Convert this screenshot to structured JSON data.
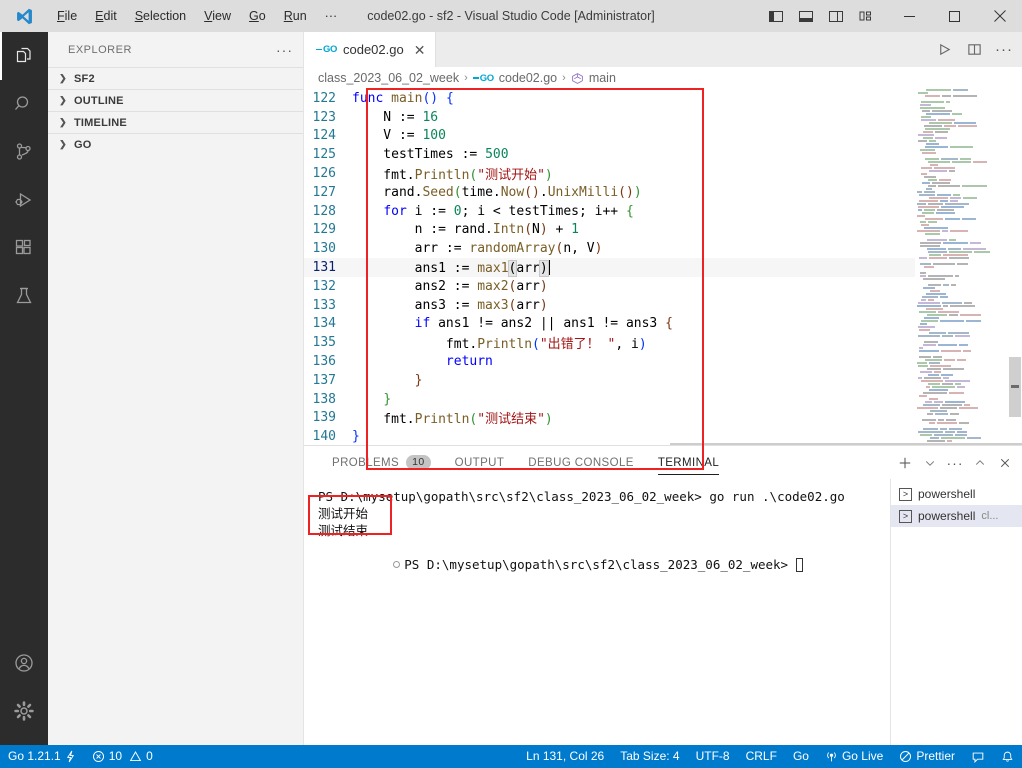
{
  "titlebar": {
    "title": "code02.go - sf2 - Visual Studio Code [Administrator]",
    "menu": [
      "File",
      "Edit",
      "Selection",
      "View",
      "Go",
      "Run",
      "···"
    ],
    "layout_buttons": [
      "toggle-primary-sidebar",
      "toggle-panel",
      "toggle-secondary-sidebar",
      "customize-layout"
    ],
    "window_buttons": {
      "minimize": "—",
      "maximize": "☐",
      "close": "✕"
    }
  },
  "activitybar": {
    "items": [
      {
        "name": "explorer",
        "active": true
      },
      {
        "name": "search",
        "active": false
      },
      {
        "name": "source-control",
        "active": false
      },
      {
        "name": "run-and-debug",
        "active": false
      },
      {
        "name": "extensions",
        "active": false
      },
      {
        "name": "testing",
        "active": false
      }
    ],
    "bottom": [
      {
        "name": "accounts"
      },
      {
        "name": "manage-settings"
      }
    ]
  },
  "sidebar": {
    "header": "EXPLORER",
    "header_more": "···",
    "sections": [
      {
        "label": "SF2",
        "expanded": false
      },
      {
        "label": "OUTLINE",
        "expanded": false
      },
      {
        "label": "TIMELINE",
        "expanded": false
      },
      {
        "label": "GO",
        "expanded": false
      }
    ]
  },
  "editor": {
    "tab": {
      "label": "code02.go",
      "icon": "GO",
      "close": "✕"
    },
    "actions": [
      "run-file",
      "split-editor",
      "more-actions"
    ],
    "breadcrumb": [
      "class_2023_06_02_week",
      "code02.go",
      "main"
    ],
    "breadcrumb_separator": "›",
    "first_line_number": 122,
    "lines": [
      {
        "n": 122,
        "tokens": [
          [
            "kw",
            "func"
          ],
          [
            "plain",
            " "
          ],
          [
            "fn",
            "main"
          ],
          [
            "brkt1",
            "()"
          ],
          [
            "plain",
            " "
          ],
          [
            "brkt1",
            "{"
          ]
        ]
      },
      {
        "n": 123,
        "tokens": [
          [
            "plain",
            "    N := "
          ],
          [
            "num",
            "16"
          ]
        ]
      },
      {
        "n": 124,
        "tokens": [
          [
            "plain",
            "    V := "
          ],
          [
            "num",
            "100"
          ]
        ]
      },
      {
        "n": 125,
        "tokens": [
          [
            "plain",
            "    testTimes := "
          ],
          [
            "num",
            "500"
          ]
        ]
      },
      {
        "n": 126,
        "tokens": [
          [
            "plain",
            "    fmt."
          ],
          [
            "fn",
            "Println"
          ],
          [
            "brkt2",
            "("
          ],
          [
            "str",
            "\"测试开始\""
          ],
          [
            "brkt2",
            ")"
          ]
        ]
      },
      {
        "n": 127,
        "tokens": [
          [
            "plain",
            "    rand."
          ],
          [
            "fn",
            "Seed"
          ],
          [
            "brkt2",
            "("
          ],
          [
            "plain",
            "time."
          ],
          [
            "fn",
            "Now"
          ],
          [
            "brkt3",
            "()"
          ],
          [
            "plain",
            "."
          ],
          [
            "fn",
            "UnixMilli"
          ],
          [
            "brkt3",
            "()"
          ],
          [
            "brkt2",
            ")"
          ]
        ]
      },
      {
        "n": 128,
        "tokens": [
          [
            "plain",
            "    "
          ],
          [
            "kw",
            "for"
          ],
          [
            "plain",
            " i := "
          ],
          [
            "num",
            "0"
          ],
          [
            "plain",
            "; i < testTimes; i++ "
          ],
          [
            "brkt2",
            "{"
          ]
        ]
      },
      {
        "n": 129,
        "tokens": [
          [
            "plain",
            "        n := rand."
          ],
          [
            "fn",
            "Intn"
          ],
          [
            "brkt3",
            "("
          ],
          [
            "plain",
            "N"
          ],
          [
            "brkt3",
            ")"
          ],
          [
            "plain",
            " + "
          ],
          [
            "num",
            "1"
          ]
        ]
      },
      {
        "n": 130,
        "tokens": [
          [
            "plain",
            "        arr := "
          ],
          [
            "fn",
            "randomArray"
          ],
          [
            "brkt3",
            "("
          ],
          [
            "plain",
            "n, V"
          ],
          [
            "brkt3",
            ")"
          ]
        ]
      },
      {
        "n": 131,
        "tokens": [
          [
            "plain",
            "        ans1 := "
          ],
          [
            "fn",
            "max1"
          ],
          [
            "sel",
            "("
          ],
          [
            "plain",
            "arr"
          ],
          [
            "sel",
            ")"
          ]
        ],
        "current": true
      },
      {
        "n": 132,
        "tokens": [
          [
            "plain",
            "        ans2 := "
          ],
          [
            "fn",
            "max2"
          ],
          [
            "brkt3",
            "("
          ],
          [
            "plain",
            "arr"
          ],
          [
            "brkt3",
            ")"
          ]
        ]
      },
      {
        "n": 133,
        "tokens": [
          [
            "plain",
            "        ans3 := "
          ],
          [
            "fn",
            "max3"
          ],
          [
            "brkt3",
            "("
          ],
          [
            "plain",
            "arr"
          ],
          [
            "brkt3",
            ")"
          ]
        ]
      },
      {
        "n": 134,
        "tokens": [
          [
            "plain",
            "        "
          ],
          [
            "kw",
            "if"
          ],
          [
            "plain",
            " ans1 != ans2 || ans1 != ans3 "
          ],
          [
            "brkt3",
            "{"
          ]
        ]
      },
      {
        "n": 135,
        "tokens": [
          [
            "plain",
            "            fmt."
          ],
          [
            "fn",
            "Println"
          ],
          [
            "brkt1",
            "("
          ],
          [
            "str",
            "\"出错了！ \""
          ],
          [
            "plain",
            ", i"
          ],
          [
            "brkt1",
            ")"
          ]
        ]
      },
      {
        "n": 136,
        "tokens": [
          [
            "plain",
            "            "
          ],
          [
            "kw",
            "return"
          ]
        ]
      },
      {
        "n": 137,
        "tokens": [
          [
            "plain",
            "        "
          ],
          [
            "brkt3",
            "}"
          ]
        ]
      },
      {
        "n": 138,
        "tokens": [
          [
            "plain",
            "    "
          ],
          [
            "brkt2",
            "}"
          ]
        ]
      },
      {
        "n": 139,
        "tokens": [
          [
            "plain",
            "    fmt."
          ],
          [
            "fn",
            "Println"
          ],
          [
            "brkt2",
            "("
          ],
          [
            "str",
            "\"测试结束\""
          ],
          [
            "brkt2",
            ")"
          ]
        ]
      },
      {
        "n": 140,
        "tokens": [
          [
            "brkt1",
            "}"
          ]
        ]
      }
    ]
  },
  "panel": {
    "tabs": [
      {
        "label": "PROBLEMS",
        "badge": "10",
        "active": false
      },
      {
        "label": "OUTPUT",
        "badge": null,
        "active": false
      },
      {
        "label": "DEBUG CONSOLE",
        "badge": null,
        "active": false
      },
      {
        "label": "TERMINAL",
        "badge": null,
        "active": true
      }
    ],
    "actions": [
      "new-terminal-icon",
      "chevron-down-icon",
      "more-actions-icon",
      "maximize-panel-icon",
      "close-panel-icon"
    ],
    "terminal_lines": [
      "PS D:\\mysetup\\gopath\\src\\sf2\\class_2023_06_02_week> go run .\\code02.go",
      "测试开始",
      "测试结束",
      "PS D:\\mysetup\\gopath\\src\\sf2\\class_2023_06_02_week> "
    ],
    "terminal_list": [
      {
        "label": "powershell",
        "sub": "",
        "active": false
      },
      {
        "label": "powershell",
        "sub": "cl...",
        "active": true
      }
    ]
  },
  "statusbar": {
    "left": [
      {
        "name": "go-version",
        "label": "Go 1.21.1",
        "icon": "lightning"
      },
      {
        "name": "problems",
        "label": "10",
        "label2": "0",
        "icon": "error-warning"
      }
    ],
    "right": [
      {
        "name": "cursor-position",
        "label": "Ln 131, Col 26"
      },
      {
        "name": "indentation",
        "label": "Tab Size: 4"
      },
      {
        "name": "encoding",
        "label": "UTF-8"
      },
      {
        "name": "eol",
        "label": "CRLF"
      },
      {
        "name": "language-mode",
        "label": "Go"
      },
      {
        "name": "go-live",
        "label": "Go Live",
        "icon": "broadcast"
      },
      {
        "name": "prettier",
        "label": "Prettier",
        "icon": "check-circle"
      },
      {
        "name": "feedback",
        "label": "",
        "icon": "feedback"
      },
      {
        "name": "notifications",
        "label": "",
        "icon": "bell"
      }
    ]
  },
  "annotations": {
    "code_highlight": "red-rectangle-around-main-function",
    "terminal_highlight": "red-rectangle-around-output"
  },
  "colors": {
    "accent": "#007acc",
    "annotation": "#ee2222",
    "titlebar": "#dddddd",
    "activitybar": "#2c2c2c",
    "sidebar": "#f3f3f3"
  }
}
